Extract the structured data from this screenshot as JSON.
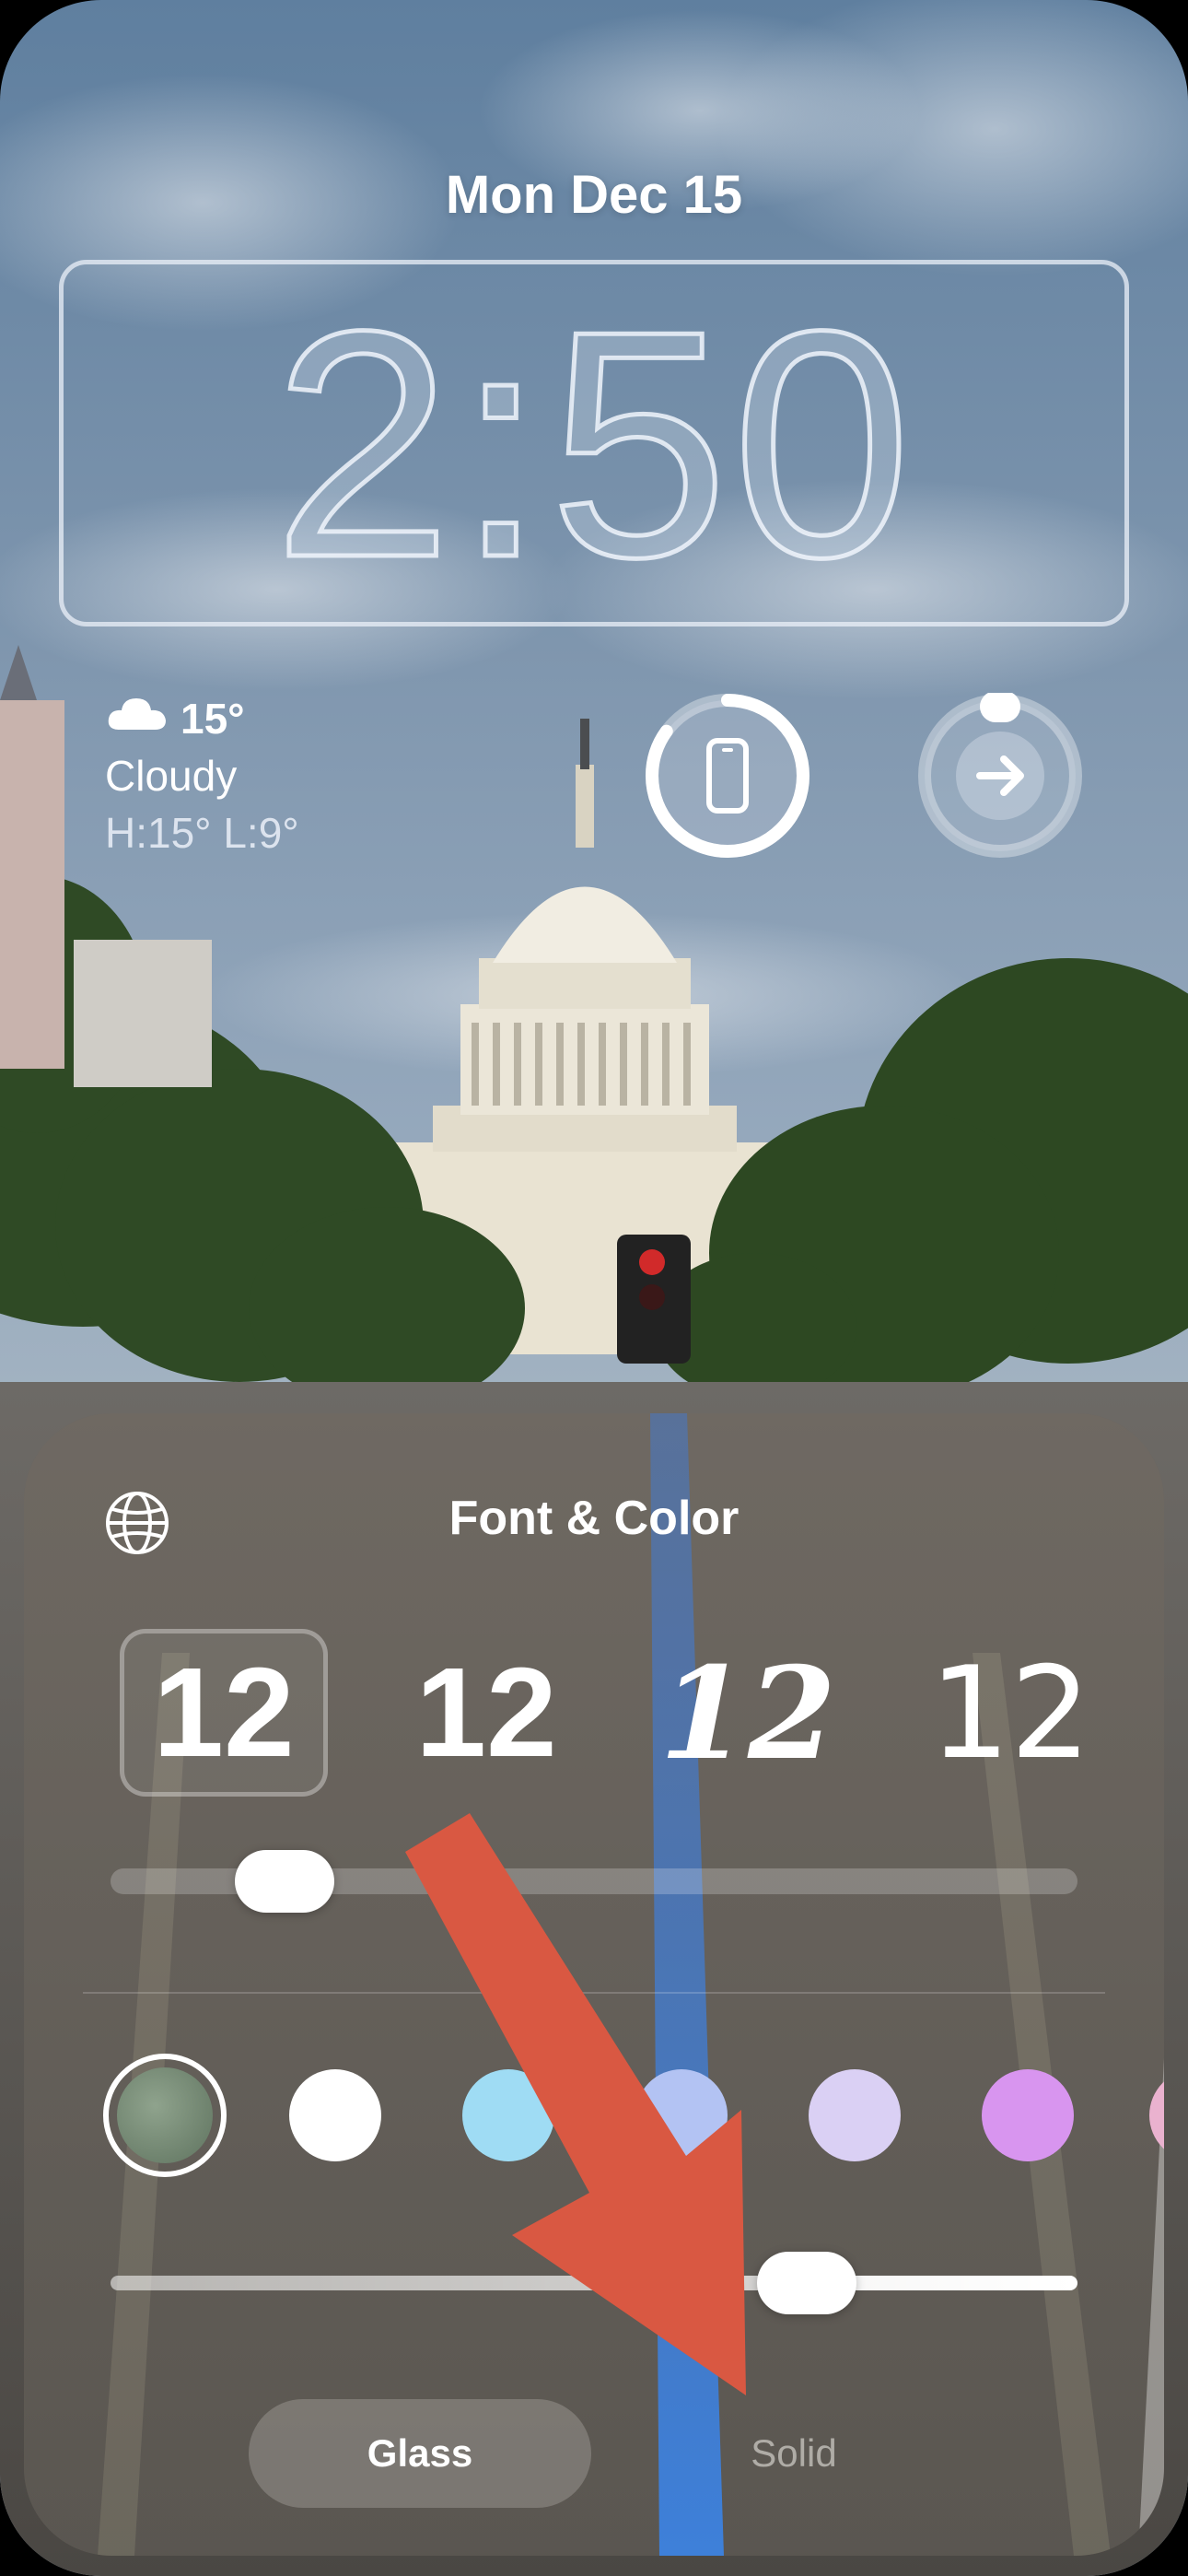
{
  "lock_screen": {
    "date": "Mon Dec 15",
    "time": "2:50",
    "weather": {
      "temperature": "15°",
      "condition": "Cloudy",
      "high_low": "H:15° L:9°",
      "icon": "cloud-icon"
    },
    "widgets": [
      {
        "name": "battery-ring-widget",
        "icon": "phone-icon",
        "progress": 0.85
      },
      {
        "name": "shortcut-ring-widget",
        "icon": "arrow-right-icon"
      }
    ]
  },
  "editor": {
    "title": "Font & Color",
    "globe_icon": "globe-icon",
    "font_options": [
      {
        "label": "12",
        "selected": true
      },
      {
        "label": "12",
        "selected": false
      },
      {
        "label": "12",
        "selected": false
      },
      {
        "label": "12",
        "selected": false
      }
    ],
    "weight_slider": {
      "value": 0.18
    },
    "color_swatches": [
      {
        "color": "#7f947c",
        "selected": true
      },
      {
        "color": "#ffffff",
        "selected": false
      },
      {
        "color": "#9fdcf4",
        "selected": false
      },
      {
        "color": "#b3c3f3",
        "selected": false
      },
      {
        "color": "#dad0f4",
        "selected": false
      },
      {
        "color": "#d895ef",
        "selected": false
      },
      {
        "color": "#eab2cf",
        "selected": false
      }
    ],
    "opacity_slider": {
      "value": 0.72
    },
    "style_options": {
      "glass": "Glass",
      "solid": "Solid",
      "selected": "Glass"
    }
  },
  "colors": {
    "annotation_arrow": "#d95842"
  }
}
